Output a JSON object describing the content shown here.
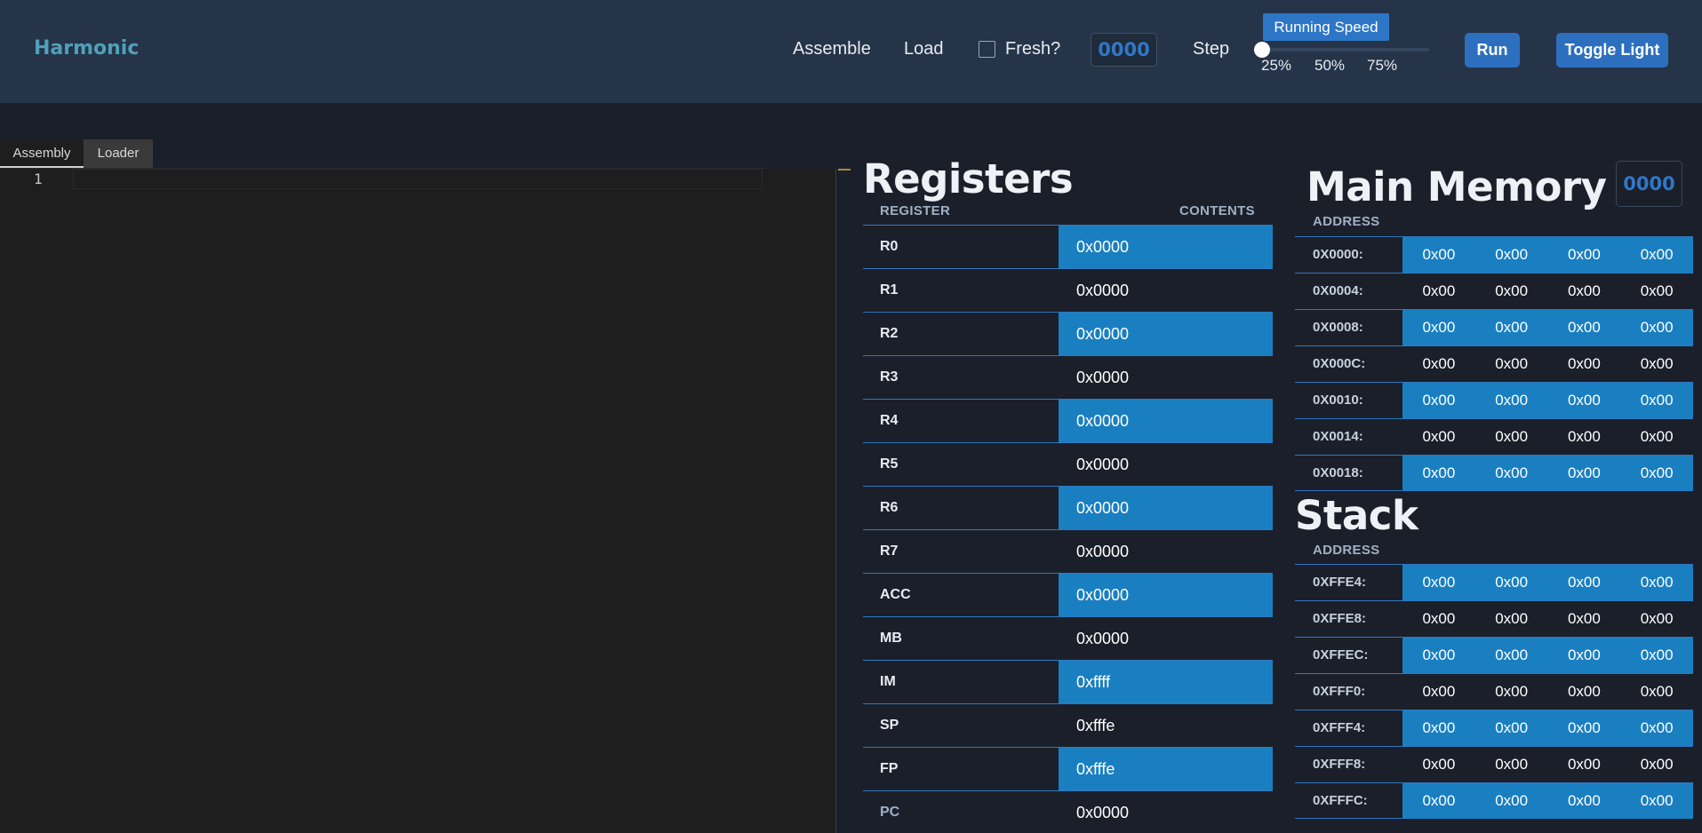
{
  "header": {
    "brand": "Harmonic",
    "assemble_label": "Assemble",
    "load_label": "Load",
    "fresh_label": "Fresh?",
    "fresh_checked": false,
    "pc_value": "0000",
    "step_label": "Step",
    "speed_tooltip": "Running Speed",
    "speed_value_percent": 0,
    "speed_ticks": [
      "25%",
      "50%",
      "75%"
    ],
    "run_label": "Run",
    "toggle_label": "Toggle Light"
  },
  "editor": {
    "tabs": [
      "Assembly",
      "Loader"
    ],
    "active_tab": "Assembly",
    "line_number": "1"
  },
  "registers": {
    "title": "Registers",
    "col_register": "REGISTER",
    "col_contents": "CONTENTS",
    "rows": [
      {
        "name": "R0",
        "value": "0x0000"
      },
      {
        "name": "R1",
        "value": "0x0000"
      },
      {
        "name": "R2",
        "value": "0x0000"
      },
      {
        "name": "R3",
        "value": "0x0000"
      },
      {
        "name": "R4",
        "value": "0x0000"
      },
      {
        "name": "R5",
        "value": "0x0000"
      },
      {
        "name": "R6",
        "value": "0x0000"
      },
      {
        "name": "R7",
        "value": "0x0000"
      },
      {
        "name": "ACC",
        "value": "0x0000"
      },
      {
        "name": "MB",
        "value": "0x0000"
      },
      {
        "name": "IM",
        "value": "0xffff"
      },
      {
        "name": "SP",
        "value": "0xfffe"
      },
      {
        "name": "FP",
        "value": "0xfffe"
      },
      {
        "name": "PC",
        "value": "0x0000"
      }
    ]
  },
  "memory": {
    "title": "Main Memory",
    "goto_value": "0000",
    "col_address": "ADDRESS",
    "rows": [
      {
        "address": "0X0000:",
        "bytes": [
          "0x00",
          "0x00",
          "0x00",
          "0x00"
        ]
      },
      {
        "address": "0X0004:",
        "bytes": [
          "0x00",
          "0x00",
          "0x00",
          "0x00"
        ]
      },
      {
        "address": "0X0008:",
        "bytes": [
          "0x00",
          "0x00",
          "0x00",
          "0x00"
        ]
      },
      {
        "address": "0X000C:",
        "bytes": [
          "0x00",
          "0x00",
          "0x00",
          "0x00"
        ]
      },
      {
        "address": "0X0010:",
        "bytes": [
          "0x00",
          "0x00",
          "0x00",
          "0x00"
        ]
      },
      {
        "address": "0X0014:",
        "bytes": [
          "0x00",
          "0x00",
          "0x00",
          "0x00"
        ]
      },
      {
        "address": "0X0018:",
        "bytes": [
          "0x00",
          "0x00",
          "0x00",
          "0x00"
        ]
      }
    ]
  },
  "stack": {
    "title": "Stack",
    "col_address": "ADDRESS",
    "rows": [
      {
        "address": "0XFFE4:",
        "bytes": [
          "0x00",
          "0x00",
          "0x00",
          "0x00"
        ]
      },
      {
        "address": "0XFFE8:",
        "bytes": [
          "0x00",
          "0x00",
          "0x00",
          "0x00"
        ]
      },
      {
        "address": "0XFFEC:",
        "bytes": [
          "0x00",
          "0x00",
          "0x00",
          "0x00"
        ]
      },
      {
        "address": "0XFFF0:",
        "bytes": [
          "0x00",
          "0x00",
          "0x00",
          "0x00"
        ]
      },
      {
        "address": "0XFFF4:",
        "bytes": [
          "0x00",
          "0x00",
          "0x00",
          "0x00"
        ]
      },
      {
        "address": "0XFFF8:",
        "bytes": [
          "0x00",
          "0x00",
          "0x00",
          "0x00"
        ]
      },
      {
        "address": "0XFFFC:",
        "bytes": [
          "0x00",
          "0x00",
          "0x00",
          "0x00"
        ]
      }
    ]
  },
  "colors": {
    "header_bg": "#253449",
    "page_bg": "#1b1f2a",
    "accent": "#2d6fbf",
    "row_highlight": "#1a7fc1",
    "brand": "#4fa1b8"
  }
}
